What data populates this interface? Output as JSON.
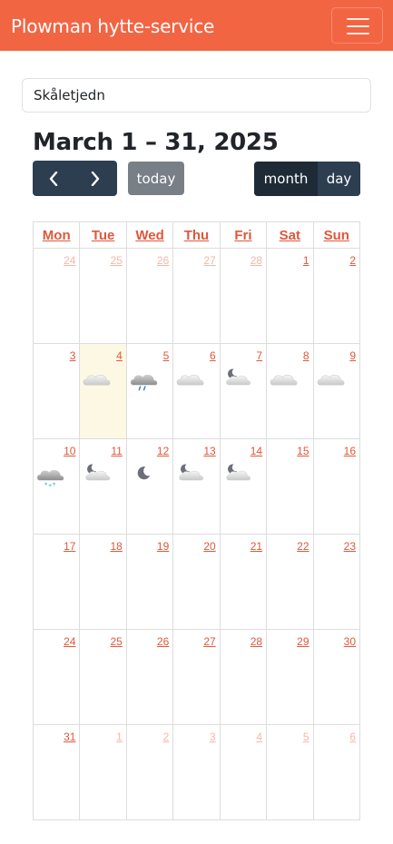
{
  "navbar": {
    "brand": "Plowman hytte-service"
  },
  "search": {
    "value": "Skåletjedn"
  },
  "calendar": {
    "title": "March 1 – 31, 2025",
    "today_label": "today",
    "month_label": "month",
    "day_label": "day",
    "weekdays": [
      "Mon",
      "Tue",
      "Wed",
      "Thu",
      "Fri",
      "Sat",
      "Sun"
    ],
    "weeks": [
      [
        {
          "d": "24",
          "o": true
        },
        {
          "d": "25",
          "o": true
        },
        {
          "d": "26",
          "o": true
        },
        {
          "d": "27",
          "o": true
        },
        {
          "d": "28",
          "o": true
        },
        {
          "d": "1"
        },
        {
          "d": "2"
        }
      ],
      [
        {
          "d": "3"
        },
        {
          "d": "4",
          "today": true,
          "w": "cloud"
        },
        {
          "d": "5",
          "w": "rain"
        },
        {
          "d": "6",
          "w": "cloud"
        },
        {
          "d": "7",
          "w": "night-cloud"
        },
        {
          "d": "8",
          "w": "cloud"
        },
        {
          "d": "9",
          "w": "cloud"
        }
      ],
      [
        {
          "d": "10",
          "w": "snow"
        },
        {
          "d": "11",
          "w": "night-cloud"
        },
        {
          "d": "12",
          "w": "moon"
        },
        {
          "d": "13",
          "w": "night-cloud"
        },
        {
          "d": "14",
          "w": "night-cloud"
        },
        {
          "d": "15"
        },
        {
          "d": "16"
        }
      ],
      [
        {
          "d": "17"
        },
        {
          "d": "18"
        },
        {
          "d": "19"
        },
        {
          "d": "20"
        },
        {
          "d": "21"
        },
        {
          "d": "22"
        },
        {
          "d": "23"
        }
      ],
      [
        {
          "d": "24"
        },
        {
          "d": "25"
        },
        {
          "d": "26"
        },
        {
          "d": "27"
        },
        {
          "d": "28"
        },
        {
          "d": "29"
        },
        {
          "d": "30"
        }
      ],
      [
        {
          "d": "31"
        },
        {
          "d": "1",
          "o": true
        },
        {
          "d": "2",
          "o": true
        },
        {
          "d": "3",
          "o": true
        },
        {
          "d": "4",
          "o": true
        },
        {
          "d": "5",
          "o": true
        },
        {
          "d": "6",
          "o": true
        }
      ]
    ]
  },
  "colors": {
    "navbar": "#f26543",
    "link": "#e0573a",
    "dark_button": "#2c3e50",
    "today_bg": "#fcf8e3"
  }
}
